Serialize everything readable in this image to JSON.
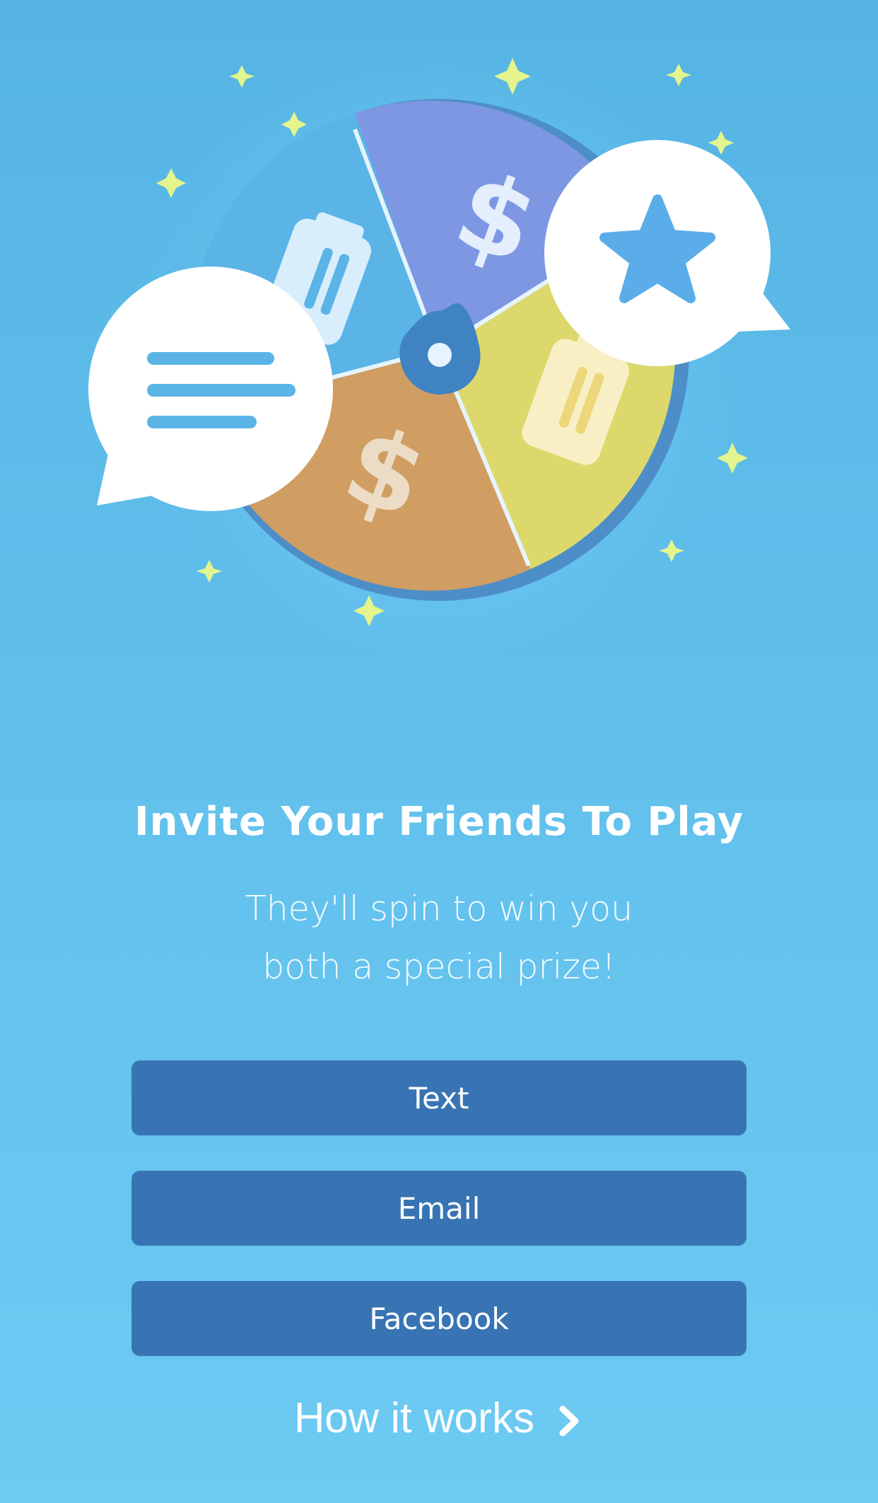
{
  "title": "Invite Your Friends To Play",
  "subtitle_line1": "They'll spin to win you",
  "subtitle_line2": "both a special prize!",
  "buttons": {
    "text": "Text",
    "email": "Email",
    "facebook": "Facebook"
  },
  "how_it_works": "How it works",
  "icons": {
    "hero": "prize-wheel-illustration",
    "chevron": "chevron-right-icon"
  },
  "colors": {
    "background": "#5fbde9",
    "button": "#3874b3",
    "text": "#ffffff"
  }
}
